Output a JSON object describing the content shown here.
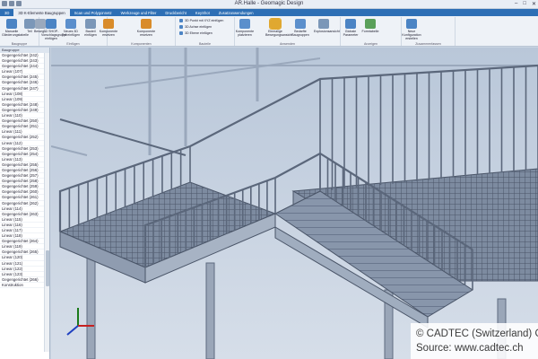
{
  "window": {
    "title": "AR.Halle - Geomagic Design",
    "controls": [
      "–",
      "□",
      "✕"
    ]
  },
  "ribbon_tabs": [
    {
      "label": "3D",
      "active": false
    },
    {
      "label": "3D K-Elemente Baugruppen",
      "active": true
    },
    {
      "label": "Scan und Polygonnetz",
      "active": false
    },
    {
      "label": "Werkzeuge und Filter",
      "active": false
    },
    {
      "label": "Druckbericht",
      "active": false
    },
    {
      "label": "KeyShot",
      "active": false
    },
    {
      "label": "Zusatzanwendungen",
      "active": false
    }
  ],
  "ribbon": {
    "groups": [
      {
        "label": "Baugruppe"
      },
      {
        "label": "Einfügen"
      },
      {
        "label": "Komponenten"
      },
      {
        "label": "Bauteile"
      },
      {
        "label": "Anwenden"
      },
      {
        "label": "Anzeigen"
      },
      {
        "label": "Zusammenfassen"
      }
    ],
    "buttons": [
      {
        "label": "Manuelle Gliederungstabelle",
        "icon": "table-icon"
      },
      {
        "label": "Teil",
        "icon": "part-icon"
      },
      {
        "label": "Beweg...",
        "icon": "move-icon"
      },
      {
        "label": "3D SHOP-Vorschlagsgruppe einfügen",
        "icon": "assembly-icon"
      },
      {
        "label": "Neues 3D Teil einfügen",
        "icon": "new-part-icon"
      },
      {
        "label": "Bauteil einfügen",
        "icon": "insert-icon"
      },
      {
        "label": "Komponente ersetzen",
        "icon": "replace-icon"
      },
      {
        "label": "Komponente ersetzen",
        "icon": "swap-icon"
      },
      {
        "label": "Komponente platzieren",
        "icon": "place-icon"
      },
      {
        "label": "Einmalige Bewegungsansicht",
        "icon": "motion-icon"
      },
      {
        "label": "Bedarfte Baugruppen",
        "icon": "group-icon"
      },
      {
        "label": "Explosionsansicht",
        "icon": "explode-icon"
      },
      {
        "label": "Globale Parameter",
        "icon": "parameter-icon"
      },
      {
        "label": "Formtabelle",
        "icon": "formtable-icon"
      },
      {
        "label": "Neue Konfiguration erstellen",
        "icon": "config-icon"
      }
    ],
    "small_items": [
      "3D Punkt mit XYZ einfügen",
      "3D Achse einfügen",
      "3D Ebene einfügen"
    ]
  },
  "panel": {
    "header": "Baugruppe",
    "tree": [
      "Gegengerichtet (242)",
      "Gegengerichtet (243)",
      "Gegengerichtet (244)",
      "Linear (107)",
      "Gegengerichtet (245)",
      "Gegengerichtet (246)",
      "Gegengerichtet (247)",
      "Linear (108)",
      "Linear (109)",
      "Gegengerichtet (248)",
      "Gegengerichtet (249)",
      "Linear (110)",
      "Gegengerichtet (250)",
      "Gegengerichtet (251)",
      "Linear (111)",
      "Gegengerichtet (252)",
      "Linear (112)",
      "Gegengerichtet (253)",
      "Gegengerichtet (254)",
      "Linear (113)",
      "Gegengerichtet (255)",
      "Gegengerichtet (256)",
      "Gegengerichtet (257)",
      "Gegengerichtet (258)",
      "Gegengerichtet (259)",
      "Gegengerichtet (260)",
      "Gegengerichtet (261)",
      "Gegengerichtet (262)",
      "Linear (114)",
      "Gegengerichtet (263)",
      "Linear (115)",
      "Linear (116)",
      "Linear (117)",
      "Linear (118)",
      "Gegengerichtet (264)",
      "Linear (119)",
      "Gegengerichtet (265)",
      "Linear (120)",
      "Linear (121)",
      "Linear (122)",
      "Linear (123)",
      "Gegengerichtet (266)",
      "Konstruktion"
    ]
  },
  "credit": {
    "line1": "© CADTEC (Switzerland) GmbH",
    "line2": "Source: www.cadtec.ch"
  },
  "colors": {
    "ribbon_tab_bar": "#2d6fb5",
    "viewport_background": "#c9d4e2",
    "steel": "#8e9bb0"
  }
}
